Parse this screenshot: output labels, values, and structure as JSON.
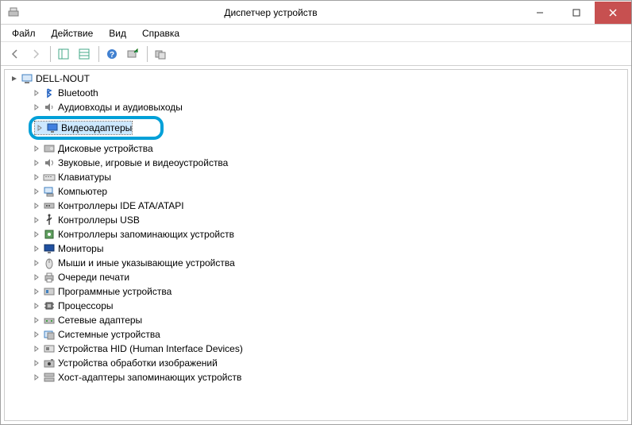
{
  "window": {
    "title": "Диспетчер устройств"
  },
  "menubar": {
    "file": "Файл",
    "action": "Действие",
    "view": "Вид",
    "help": "Справка"
  },
  "tree": {
    "root": "DELL-NOUT",
    "items": [
      {
        "label": "Bluetooth",
        "icon": "bluetooth"
      },
      {
        "label": "Аудиовходы и аудиовыходы",
        "icon": "audio"
      },
      {
        "label": "Видеоадаптеры",
        "icon": "display",
        "highlight": true
      },
      {
        "label": "Дисковые устройства",
        "icon": "disk"
      },
      {
        "label": "Звуковые, игровые и видеоустройства",
        "icon": "sound"
      },
      {
        "label": "Клавиатуры",
        "icon": "keyboard"
      },
      {
        "label": "Компьютер",
        "icon": "computer"
      },
      {
        "label": "Контроллеры IDE ATA/ATAPI",
        "icon": "ide"
      },
      {
        "label": "Контроллеры USB",
        "icon": "usb"
      },
      {
        "label": "Контроллеры запоминающих устройств",
        "icon": "storage"
      },
      {
        "label": "Мониторы",
        "icon": "monitor"
      },
      {
        "label": "Мыши и иные указывающие устройства",
        "icon": "mouse"
      },
      {
        "label": "Очереди печати",
        "icon": "printer"
      },
      {
        "label": "Программные устройства",
        "icon": "software"
      },
      {
        "label": "Процессоры",
        "icon": "cpu"
      },
      {
        "label": "Сетевые адаптеры",
        "icon": "network"
      },
      {
        "label": "Системные устройства",
        "icon": "system"
      },
      {
        "label": "Устройства HID (Human Interface Devices)",
        "icon": "hid"
      },
      {
        "label": "Устройства обработки изображений",
        "icon": "imaging"
      },
      {
        "label": "Хост-адаптеры запоминающих устройств",
        "icon": "hoststorage"
      }
    ]
  }
}
